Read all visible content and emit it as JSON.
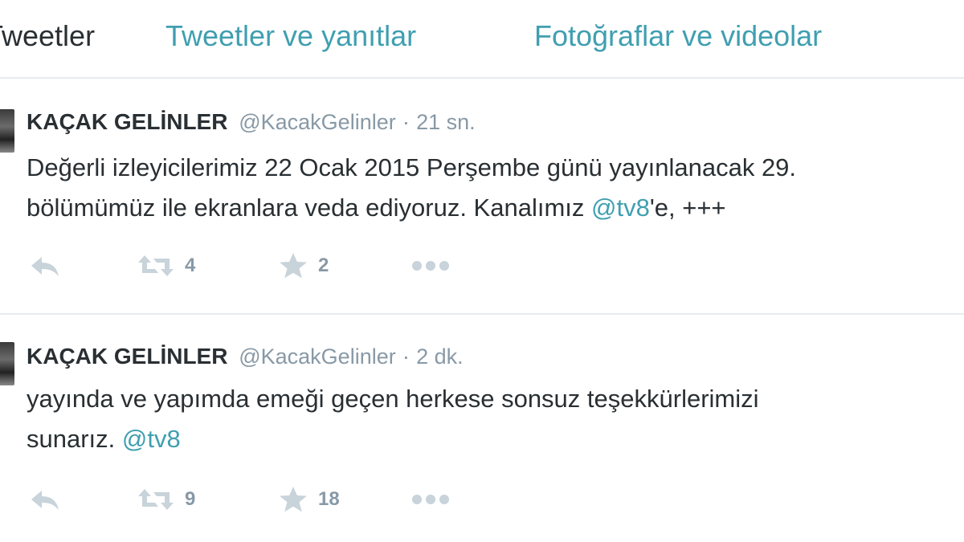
{
  "tabs": [
    {
      "label": "Tweetler"
    },
    {
      "label": "Tweetler ve yanıtlar"
    },
    {
      "label": "Fotoğraflar ve videolar"
    }
  ],
  "tweets": [
    {
      "name": "KAÇAK GELİNLER",
      "handle": "@KacakGelinler",
      "separator": "·",
      "time": "21 sn.",
      "line1": "Değerli izleyicilerimiz 22 Ocak 2015 Perşembe günü yayınlanacak 29.",
      "line2_a": "bölümümüz ile ekranlara veda ediyoruz. Kanalımız ",
      "line2_mention": "@tv8",
      "line2_b": "'e, +++",
      "retweets": "4",
      "favorites": "2"
    },
    {
      "name": "KAÇAK GELİNLER",
      "handle": "@KacakGelinler",
      "separator": "·",
      "time": "2 dk.",
      "line1": "yayında ve yapımda emeği geçen herkese sonsuz teşekkürlerimizi",
      "line2_a": "sunarız. ",
      "line2_mention": "@tv8",
      "line2_b": "",
      "retweets": "9",
      "favorites": "18"
    }
  ],
  "icons": {
    "reply": "reply-icon",
    "retweet": "retweet-icon",
    "favorite": "star-icon",
    "more": "more-dots-icon"
  },
  "colors": {
    "link": "#3f9fb0",
    "muted": "#8899a6",
    "icon": "#aab8c2",
    "text": "#292f33"
  }
}
